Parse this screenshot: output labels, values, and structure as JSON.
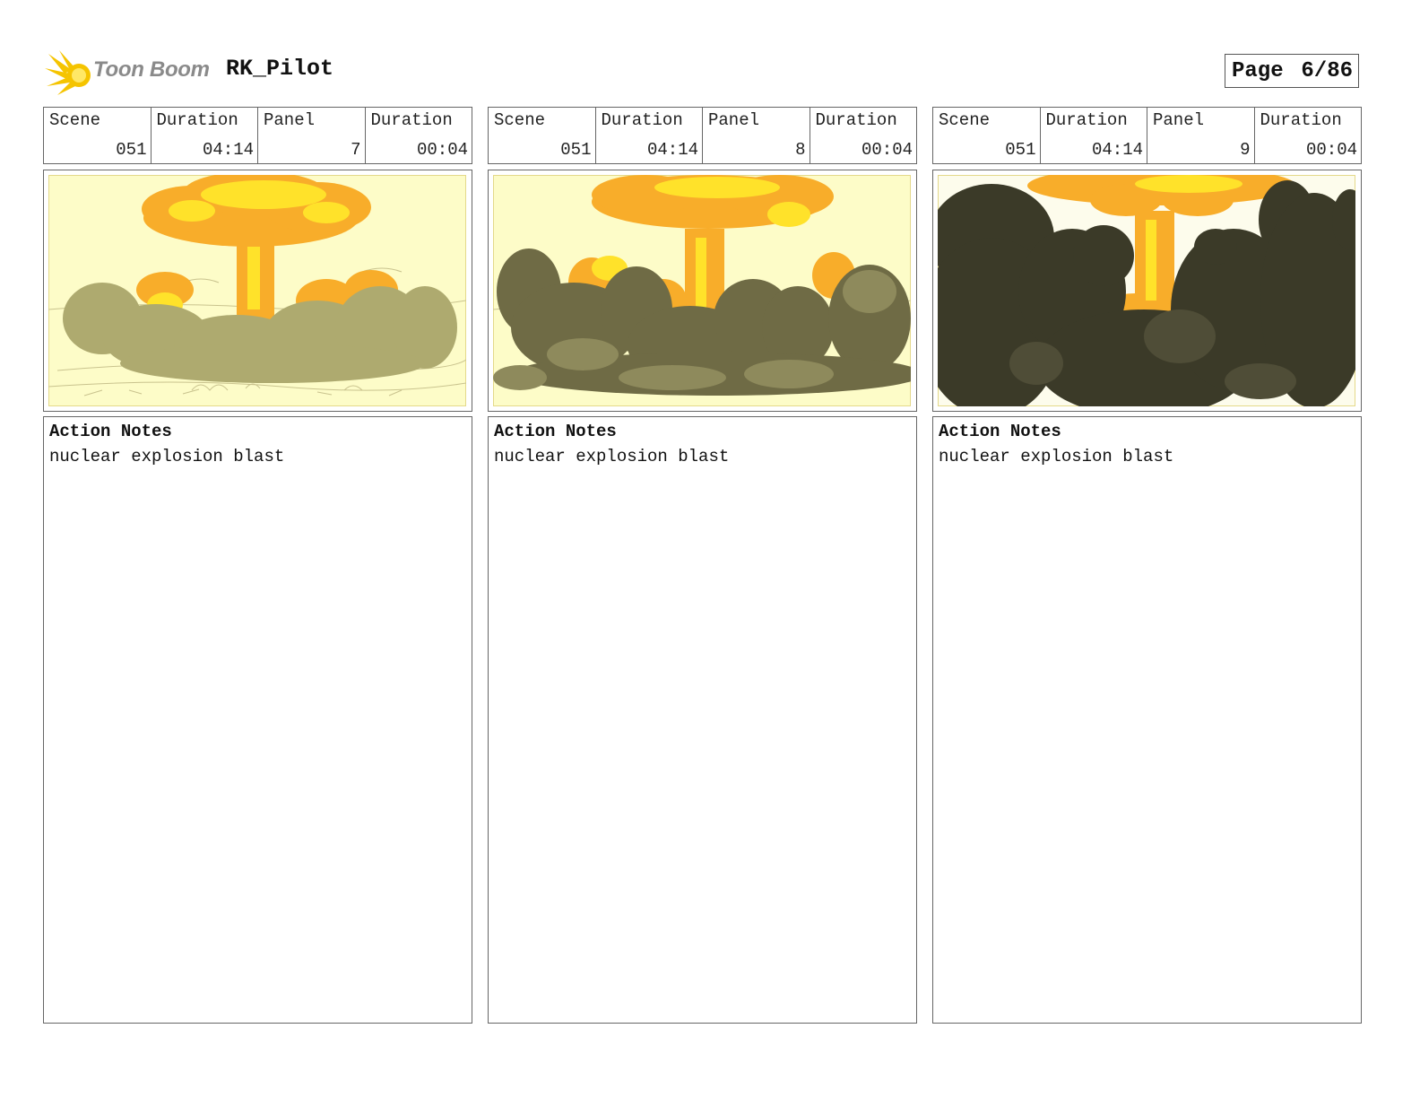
{
  "header": {
    "brand": "Toon Boom",
    "project": "RK_Pilot",
    "page_label": "Page",
    "page_value": "6/86"
  },
  "panels": [
    {
      "scene_label": "Scene",
      "scene": "051",
      "scene_duration_label": "Duration",
      "scene_duration": "04:14",
      "panel_label": "Panel",
      "panel": "7",
      "panel_duration_label": "Duration",
      "panel_duration": "00:04",
      "image_icon": "nuclear-explosion-sketch",
      "notes_title": "Action Notes",
      "notes_text": "nuclear explosion blast"
    },
    {
      "scene_label": "Scene",
      "scene": "051",
      "scene_duration_label": "Duration",
      "scene_duration": "04:14",
      "panel_label": "Panel",
      "panel": "8",
      "panel_duration_label": "Duration",
      "panel_duration": "00:04",
      "image_icon": "nuclear-explosion-smoke",
      "notes_title": "Action Notes",
      "notes_text": "nuclear explosion blast"
    },
    {
      "scene_label": "Scene",
      "scene": "051",
      "scene_duration_label": "Duration",
      "scene_duration": "04:14",
      "panel_label": "Panel",
      "panel": "9",
      "panel_duration_label": "Duration",
      "panel_duration": "00:04",
      "image_icon": "nuclear-explosion-dark-smoke",
      "notes_title": "Action Notes",
      "notes_text": "nuclear explosion blast"
    }
  ],
  "colors": {
    "sky": "#fdfcc8",
    "fire_yellow": "#ffe22a",
    "fire_orange": "#f8ad2a",
    "smoke_light": "#aeaa6f",
    "smoke_mid": "#6f6b45",
    "smoke_dark": "#3b3a28"
  }
}
